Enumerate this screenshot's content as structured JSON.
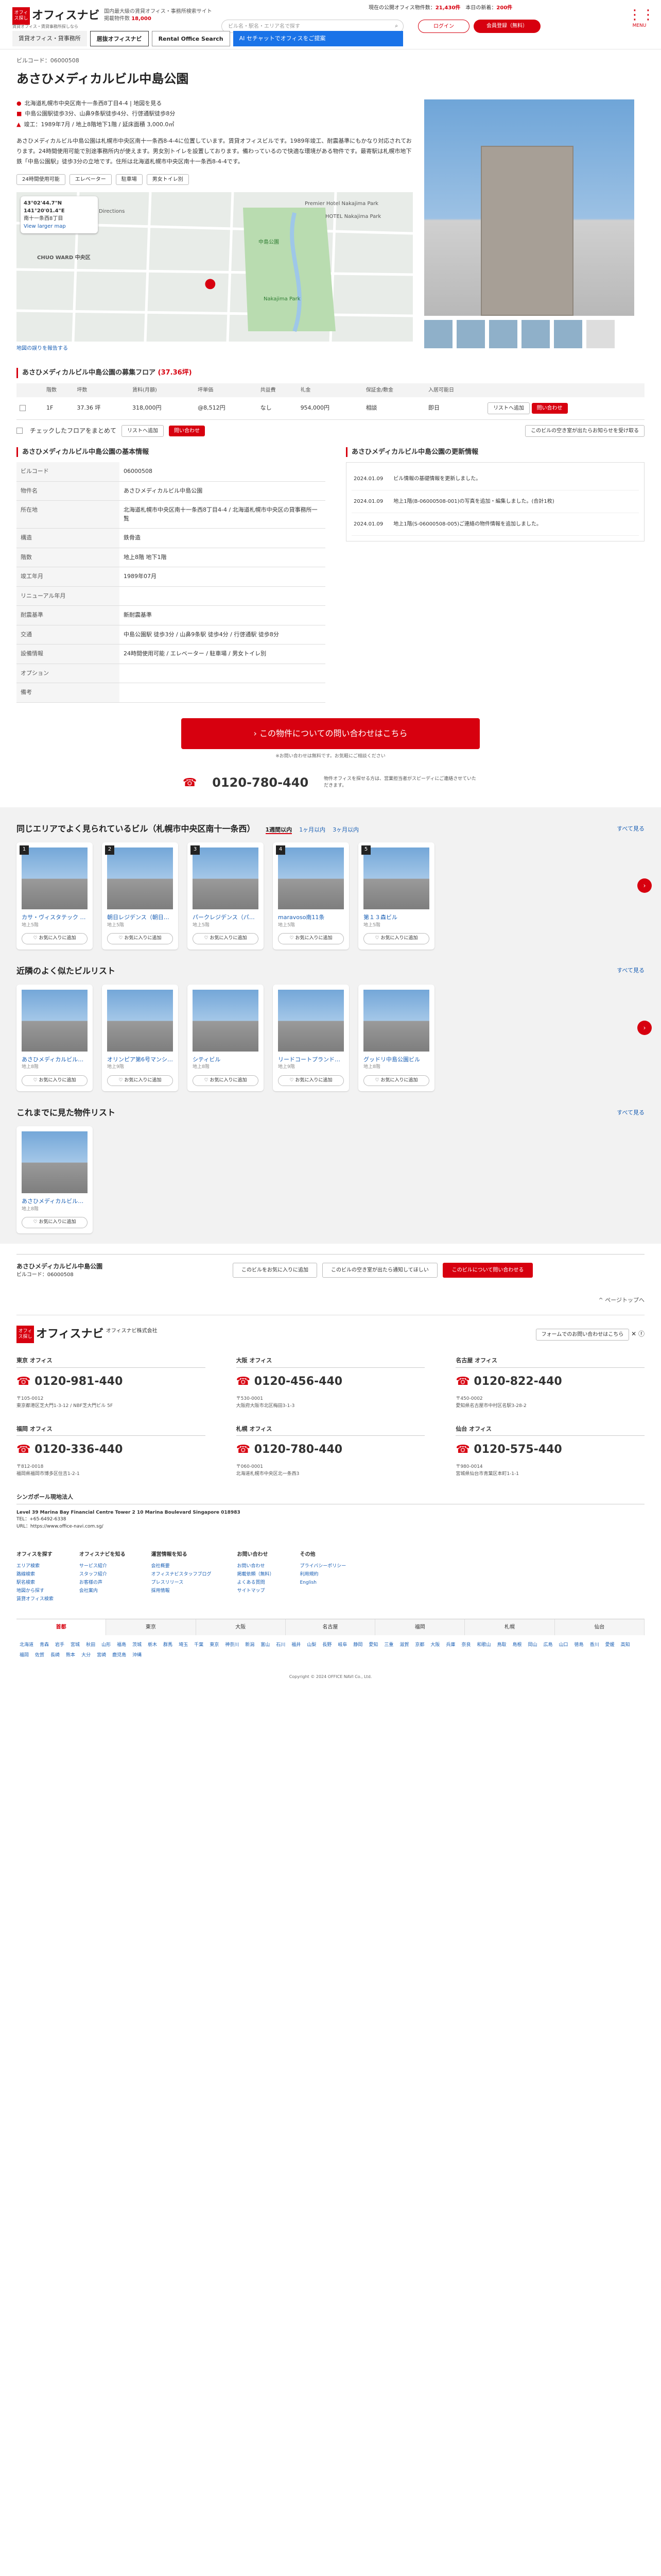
{
  "header": {
    "logo_badge": "オフィス探し",
    "logo_name": "オフィスナビ",
    "logo_tag": "賃貸オフィス・賃貸事務所探しなら",
    "caption": "国内最大級の賃貸オフィス・事務所検索サイト",
    "stats_line": "掲載物件数",
    "stats_count": "18,000",
    "top_label": "現在の公開オフィス物件数：",
    "top_count": "21,430件",
    "today_label": "本日の新着：",
    "today_count": "200件",
    "search_placeholder": "ビル名・駅名・エリア名で探す",
    "login": "ログイン",
    "register": "会員登録（無料）",
    "menu": "MENU",
    "banners": [
      "賃貸オフィス・貸事務所",
      "居抜オフィスナビ",
      "Rental Office Search",
      "AI セチャットでオフィスをご提案"
    ]
  },
  "breadcrumb": "ビルコード：06000508",
  "title": "あさひメディカルビル中島公園",
  "address": [
    "北海道札幌市中央区南十一条西8丁目4-4 | 地図を見る",
    "中島公園駅徒歩3分、山鼻9条駅徒歩4分、行啓通駅徒歩8分",
    "竣工：1989年7月 / 地上8階地下1階 / 延床面積 3,000.0㎡"
  ],
  "description": "あさひメディカルビル中島公園は札幌市中央区南十一条西8-4-4に位置しています。賃貸オフィスビルです。1989年竣工、耐震基準にもかなり対応されております。24時間使用可能で別途事務所内が使えます。男女別トイレを設置しております。備わっているので快適な環境がある物件です。最寄駅は札幌市地下鉄「中島公園駅」徒歩3分の立地です。住所は北海道札幌市中央区南十一条西8-4-4です。",
  "tags": [
    "24時間使用可能",
    "エレベーター",
    "駐車場",
    "男女トイレ別"
  ],
  "map": {
    "coords": "43°02'44.7\"N 141°20'01.4\"E",
    "place": "南十一条西8丁目",
    "view": "View larger map",
    "directions": "Directions",
    "labels": [
      "中島公園",
      "CHUO WARD 中央区",
      "HOTEL Nakajima Park",
      "Nakajima Park",
      "Premier Hotel Nakajima Park"
    ]
  },
  "map_note": "地図の誤りを報告する",
  "floor": {
    "heading": "あさひメディカルビル中島公園の募集フロア",
    "count": "(37.36坪)",
    "headers": [
      "",
      "階数",
      "坪数",
      "賃料(月額)",
      "坪単価",
      "共益費",
      "礼金",
      "保証金/敷金",
      "入居可能日",
      ""
    ],
    "rows": [
      [
        "1F",
        "37.36 坪",
        "318,000円",
        "@8,512円",
        "なし",
        "954,000円",
        "相談",
        "即日"
      ]
    ],
    "check_label": "チェックしたフロアをまとめて",
    "btn_fav": "リストへ追加",
    "btn_inq": "問い合わせ",
    "note": "このビルの空き室が出たらお知らせを受け取る"
  },
  "basic": {
    "heading": "あさひメディカルビル中島公園の基本情報",
    "rows": [
      [
        "ビルコード",
        "06000508"
      ],
      [
        "物件名",
        "あさひメディカルビル中島公園"
      ],
      [
        "所在地",
        "北海道札幌市中央区南十一条西8丁目4-4 / 北海道札幌市中央区の貸事務所一覧"
      ],
      [
        "構造",
        "鉄骨造"
      ],
      [
        "階数",
        "地上8階 地下1階"
      ],
      [
        "竣工年月",
        "1989年07月"
      ],
      [
        "リニューアル年月",
        ""
      ],
      [
        "耐震基準",
        "新耐震基準"
      ],
      [
        "交通",
        "中島公園駅 徒歩3分 / 山鼻9条駅 徒歩4分 / 行啓通駅 徒歩8分"
      ],
      [
        "設備情報",
        "24時間使用可能 / エレベーター / 駐車場 / 男女トイレ別"
      ],
      [
        "オプション",
        ""
      ],
      [
        "備考",
        ""
      ]
    ]
  },
  "history": {
    "heading": "あさひメディカルビル中島公園の更新情報",
    "rows": [
      [
        "2024.01.09",
        "ビル情報の基礎情報を更新しました。"
      ],
      [
        "2024.01.09",
        "地上1階(B-06000508-001)の写真を追加・編集しました。(合計1枚)"
      ],
      [
        "2024.01.09",
        "地上1階(S-06000508-005)ご連絡の物件情報を追加しました。"
      ]
    ]
  },
  "cta": {
    "label": "この物件についての問い合わせはこちら",
    "note": "※お問い合わせは無料です。お気軽にご相談ください",
    "tel": "0120-780-440",
    "tel_note": "物件オフィスを探せる方は、営業担当者がスピーディにご連絡させていただきます。"
  },
  "popular": {
    "title": "同じエリアでよく見られているビル（札幌市中央区南十一条西）",
    "tabs": [
      "1週間以内",
      "1ヶ月以内",
      "3ヶ月以内"
    ],
    "more": "すべて見る",
    "items": [
      [
        "1",
        "カサ・ヴィスタテック 中央",
        "地上5階"
      ],
      [
        "2",
        "朝日レジデンス（朝日ビル）",
        "地上5階"
      ],
      [
        "3",
        "パークレジデンス（パーク",
        "地上5階"
      ],
      [
        "4",
        "maravoso南11条",
        "地上5階"
      ],
      [
        "5",
        "第１３森ビル",
        "地上5階"
      ]
    ]
  },
  "nearby": {
    "title": "近隣のよく似たビルリスト",
    "more": "すべて見る",
    "items": [
      [
        "あさひメディカルビル中島公園",
        "地上8階"
      ],
      [
        "オリンピア第6号マンション",
        "地上9階"
      ],
      [
        "シティビル",
        "地上8階"
      ],
      [
        "リードコートプランドル大",
        "地上9階"
      ],
      [
        "グッドリ中島公園ビル",
        "地上8階"
      ]
    ]
  },
  "history_list": {
    "title": "これまでに見た物件リスト",
    "more": "すべて見る",
    "items": [
      [
        "あさひメディカルビル中島",
        "地上8階"
      ]
    ]
  },
  "fav": "お気に入りに追加",
  "bottom_bar": {
    "name": "あさひメディカルビル中島公園",
    "code": "ビルコード：06000508",
    "b1": "このビルをお気に入りに追加",
    "b2": "このビルの空き室が出たら通知してほしい",
    "b3": "このビルについて問い合わせる"
  },
  "pagetop": "ページトップへ",
  "footer": {
    "company": "オフィスナビ株式会社",
    "form": "フォームでのお問い合わせはこちら",
    "offices": [
      [
        "東京 オフィス",
        "0120-981-440",
        "〒105-0012",
        "東京都港区芝大門1-3-12 / NBF芝大門ビル 5F"
      ],
      [
        "大阪 オフィス",
        "0120-456-440",
        "〒530-0001",
        "大阪府大阪市北区梅田3-1-3"
      ],
      [
        "名古屋 オフィス",
        "0120-822-440",
        "〒450-0002",
        "愛知県名古屋市中村区名駅3-28-2"
      ],
      [
        "福岡 オフィス",
        "0120-336-440",
        "〒812-0018",
        "福岡県福岡市博多区住吉1-2-1"
      ],
      [
        "札幌 オフィス",
        "0120-780-440",
        "〒060-0001",
        "北海道札幌市中央区北一条西3"
      ],
      [
        "仙台 オフィス",
        "0120-575-440",
        "〒980-0014",
        "宮城県仙台市青葉区本町1-1-1"
      ]
    ],
    "sg": {
      "h": "シンガポール現地法人",
      "a": "Level 39 Marina Bay Financial Centre Tower 2 10 Marina Boulevard Singapore 018983",
      "tel": "TEL：+65-6492-6338",
      "url": "URL：https://www.office-navi.com.sg/"
    },
    "linkcols": [
      [
        "オフィスを探す",
        "エリア検索",
        "路線検索",
        "駅名検索",
        "地図から探す",
        "賃貸オフィス検索"
      ],
      [
        "オフィスナビを知る",
        "サービス紹介",
        "スタッフ紹介",
        "お客様の声",
        "会社案内"
      ],
      [
        "運営情報を知る",
        "会社概要",
        "オフィスナビスタッフブログ",
        "プレスリリース",
        "採用情報"
      ],
      [
        "お問い合わせ",
        "お問い合わせ",
        "掲載依頼（無料）",
        "よくある質問",
        "サイトマップ"
      ],
      [
        "その他",
        "プライバシーポリシー",
        "利用規約",
        "English"
      ]
    ],
    "regions": [
      "首都",
      "東京",
      "大阪",
      "名古屋",
      "福岡",
      "札幌",
      "仙台"
    ],
    "areas": [
      "北海道",
      "青森",
      "岩手",
      "宮城",
      "秋田",
      "山形",
      "福島",
      "茨城",
      "栃木",
      "群馬",
      "埼玉",
      "千葉",
      "東京",
      "神奈川",
      "新潟",
      "富山",
      "石川",
      "福井",
      "山梨",
      "長野",
      "岐阜",
      "静岡",
      "愛知",
      "三重",
      "滋賀",
      "京都",
      "大阪",
      "兵庫",
      "奈良",
      "和歌山",
      "鳥取",
      "島根",
      "岡山",
      "広島",
      "山口",
      "徳島",
      "香川",
      "愛媛",
      "高知",
      "福岡",
      "佐賀",
      "長崎",
      "熊本",
      "大分",
      "宮崎",
      "鹿児島",
      "沖縄"
    ],
    "copyright": "Copyright © 2024 OFFICE NAVI Co., Ltd."
  }
}
